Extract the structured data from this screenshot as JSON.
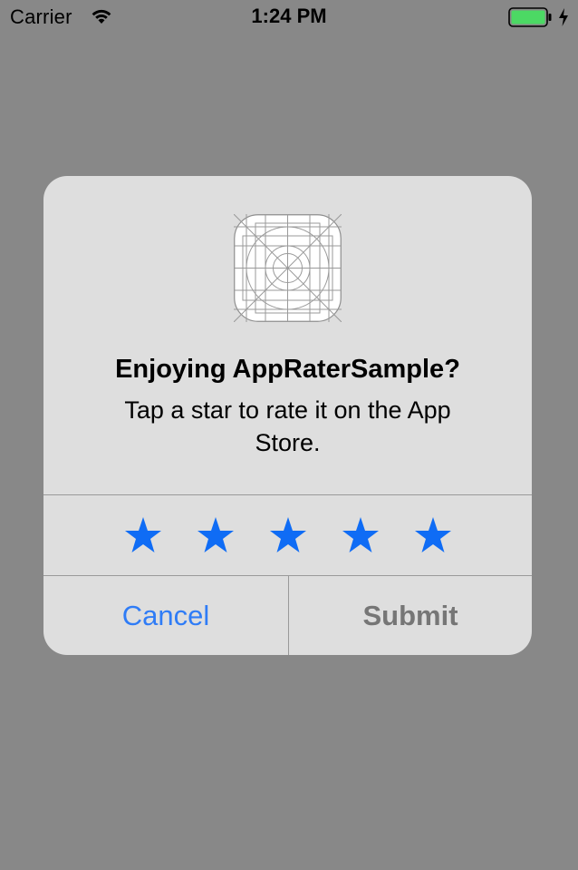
{
  "status_bar": {
    "carrier": "Carrier",
    "time": "1:24 PM",
    "battery_color": "#4cd964"
  },
  "background_color": "#888888",
  "alert": {
    "icon": "app-icon-placeholder",
    "title": "Enjoying AppRaterSample?",
    "message": "Tap a star to rate it on the App Store.",
    "rating": {
      "max": 5,
      "star_glyph": "★",
      "star_color": "#0f6cf5"
    },
    "buttons": {
      "cancel_label": "Cancel",
      "submit_label": "Submit"
    }
  }
}
